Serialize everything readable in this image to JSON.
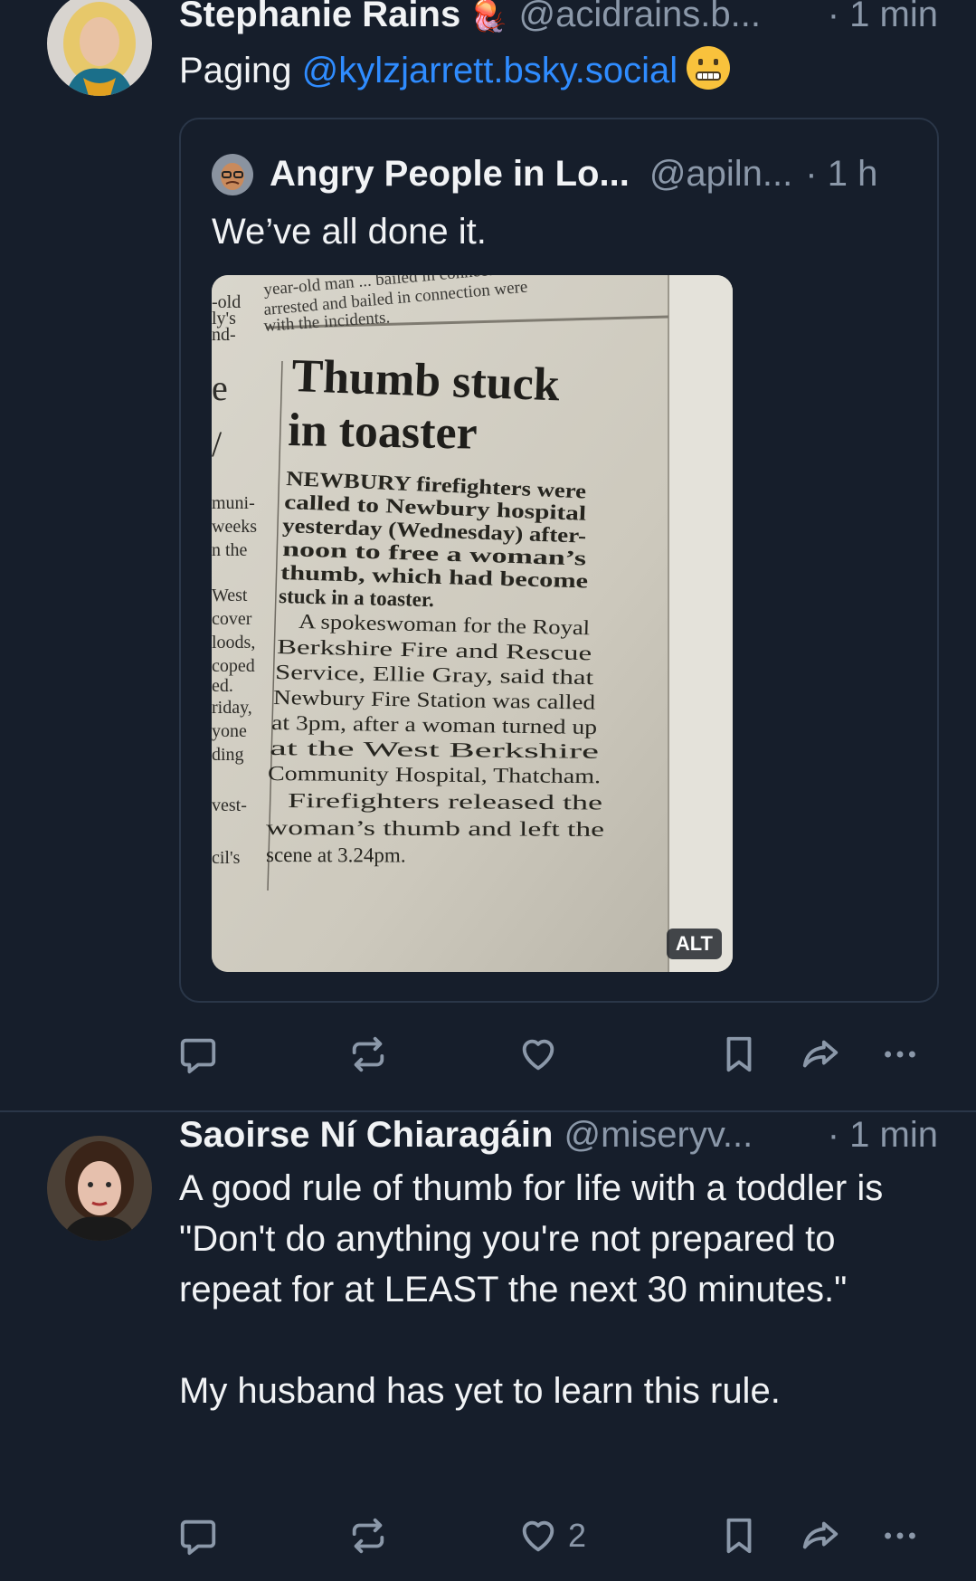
{
  "post1": {
    "display_name": "Stephanie Rains",
    "badge_emoji": "🪼",
    "handle": "@acidrains.b...",
    "time": "· 1 min",
    "text_prefix": "Paging ",
    "mention": "@kylzjarrett.bsky.social",
    "emoji_icon": "grimacing-face",
    "quote": {
      "display_name": "Angry People in Lo...",
      "handle": "@apiln...",
      "time": "· 1 h",
      "text": "We’ve all done it.",
      "image": {
        "top_snippet": [
          "year-old man ... bailed in connection",
          "arrested and bailed in connection were",
          "with the incidents."
        ],
        "left_column": [
          "-old",
          "ly's",
          "nd-",
          "e",
          "/",
          "muni-",
          "weeks",
          "n the",
          "West",
          "cover",
          "loods,",
          "coped",
          "ed.",
          "riday,",
          "yone",
          "ding",
          "vest-",
          "cil's"
        ],
        "headline": [
          "Thumb stuck",
          "in toaster"
        ],
        "body": [
          "NEWBURY firefighters were",
          "called to Newbury hospital",
          "yesterday (Wednesday) after-",
          "noon to free a woman’s",
          "thumb, which had become",
          "stuck in a toaster.",
          "A spokeswoman for the Royal",
          "Berkshire Fire and Rescue",
          "Service, Ellie Gray, said that",
          "Newbury Fire Station was called",
          "at 3pm, after a woman turned up",
          "at the West Berkshire",
          "Community Hospital, Thatcham.",
          "Firefighters released the",
          "woman’s thumb and left the",
          "scene at 3.24pm."
        ],
        "alt_label": "ALT"
      }
    },
    "actions": {
      "like_count": ""
    }
  },
  "post2": {
    "display_name": "Saoirse Ní Chiaragáin",
    "handle": "@miseryv...",
    "time": "· 1 min",
    "text": "A good rule of thumb for life with a toddler is \"Don't do anything you're not prepared to repeat for at LEAST the next 30 minutes.\"\n\nMy husband has yet to learn this rule.",
    "actions": {
      "like_count": "2"
    }
  },
  "icons": [
    "reply-icon",
    "repost-icon",
    "like-icon",
    "bookmark-icon",
    "share-icon",
    "more-icon"
  ],
  "colors": {
    "background": "#161e2b",
    "link": "#2f8cff",
    "muted": "#8b98a9",
    "border": "#2a3648"
  }
}
